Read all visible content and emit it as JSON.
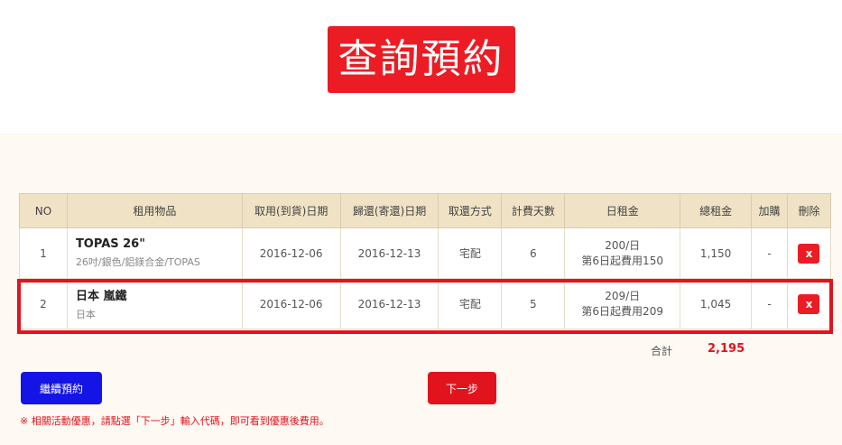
{
  "title": "查詢預約",
  "table": {
    "headers": [
      "NO",
      "租用物品",
      "取用(到貨)日期",
      "歸還(寄還)日期",
      "取還方式",
      "計費天數",
      "日租金",
      "總租金",
      "加購",
      "刪除"
    ],
    "rows": [
      {
        "no": "1",
        "item_name": "TOPAS 26\"",
        "item_desc": "26吋/銀色/鋁鎂合金/TOPAS",
        "pickup_date": "2016-12-06",
        "return_date": "2016-12-13",
        "method": "宅配",
        "days": "6",
        "rate_line1": "200/日",
        "rate_line2": "第6日起費用150",
        "total": "1,150",
        "addon": "-",
        "delete": "x"
      },
      {
        "no": "2",
        "item_name": "日本 嵐鐵",
        "item_desc": "日本",
        "pickup_date": "2016-12-06",
        "return_date": "2016-12-13",
        "method": "宅配",
        "days": "5",
        "rate_line1": "209/日",
        "rate_line2": "第6日起費用209",
        "total": "1,045",
        "addon": "-",
        "delete": "x"
      }
    ]
  },
  "summary": {
    "label": "合計",
    "value": "2,195"
  },
  "buttons": {
    "continue": "繼續預約",
    "next": "下一步"
  },
  "note": "※ 相關活動優惠，請點選「下一步」輸入代碼，即可看到優惠後費用。",
  "colors": {
    "accent": "#e1141e",
    "header_bg": "#f0e3c5",
    "continue_bg": "#1414e6"
  }
}
